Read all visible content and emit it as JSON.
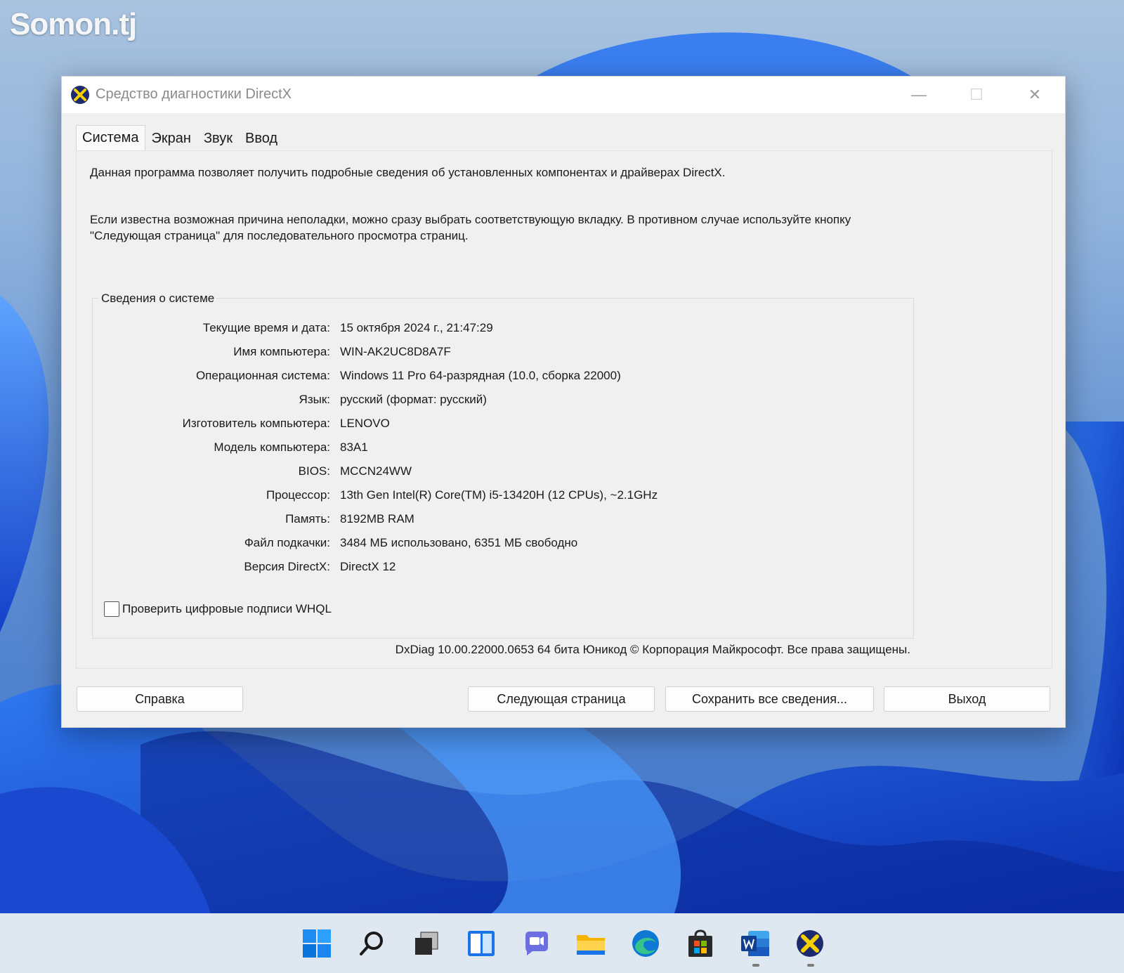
{
  "watermark": "Somon.tj",
  "window": {
    "title": "Средство диагностики DirectX",
    "minimize_glyph": "—",
    "maximize_glyph": "☐",
    "close_glyph": "✕"
  },
  "tabs": [
    {
      "label": "Система",
      "active": true
    },
    {
      "label": "Экран",
      "active": false
    },
    {
      "label": "Звук",
      "active": false
    },
    {
      "label": "Ввод",
      "active": false
    }
  ],
  "description": {
    "line1": "Данная программа позволяет получить подробные сведения об установленных компонентах и драйверах DirectX.",
    "line2": "Если известна возможная причина неполадки, можно сразу выбрать соответствующую вкладку. В противном случае используйте кнопку \"Следующая страница\" для последовательного просмотра страниц."
  },
  "system_info": {
    "group_title": "Сведения о системе",
    "rows": [
      {
        "label": "Текущие время и дата:",
        "value": "15 октября 2024 г., 21:47:29"
      },
      {
        "label": "Имя компьютера:",
        "value": "WIN-AK2UC8D8A7F"
      },
      {
        "label": "Операционная система:",
        "value": "Windows 11 Pro 64-разрядная (10.0, сборка 22000)"
      },
      {
        "label": "Язык:",
        "value": "русский (формат: русский)"
      },
      {
        "label": "Изготовитель компьютера:",
        "value": "LENOVO"
      },
      {
        "label": "Модель компьютера:",
        "value": "83A1"
      },
      {
        "label": "BIOS:",
        "value": "MCCN24WW"
      },
      {
        "label": "Процессор:",
        "value": "13th Gen Intel(R) Core(TM) i5-13420H (12 CPUs), ~2.1GHz"
      },
      {
        "label": "Память:",
        "value": "8192MB RAM"
      },
      {
        "label": "Файл подкачки:",
        "value": "3484 МБ использовано, 6351 МБ свободно"
      },
      {
        "label": "Версия DirectX:",
        "value": "DirectX 12"
      }
    ]
  },
  "whql_checkbox": {
    "label": "Проверить цифровые подписи WHQL",
    "checked": false
  },
  "footer": "DxDiag 10.00.22000.0653 64 бита Юникод © Корпорация Майкрософт. Все права защищены.",
  "buttons": {
    "help": "Справка",
    "next": "Следующая страница",
    "save": "Сохранить все сведения...",
    "exit": "Выход"
  },
  "taskbar": {
    "icons": [
      "start-icon",
      "search-icon",
      "task-view-icon",
      "widgets-icon",
      "chat-icon",
      "file-explorer-icon",
      "edge-icon",
      "store-icon",
      "word-icon",
      "dxdiag-icon"
    ]
  },
  "colors": {
    "window_bg": "#f0f0f0",
    "taskbar_bg": "#dfe7f1",
    "wallpaper_blue": "#1f5fd6"
  }
}
